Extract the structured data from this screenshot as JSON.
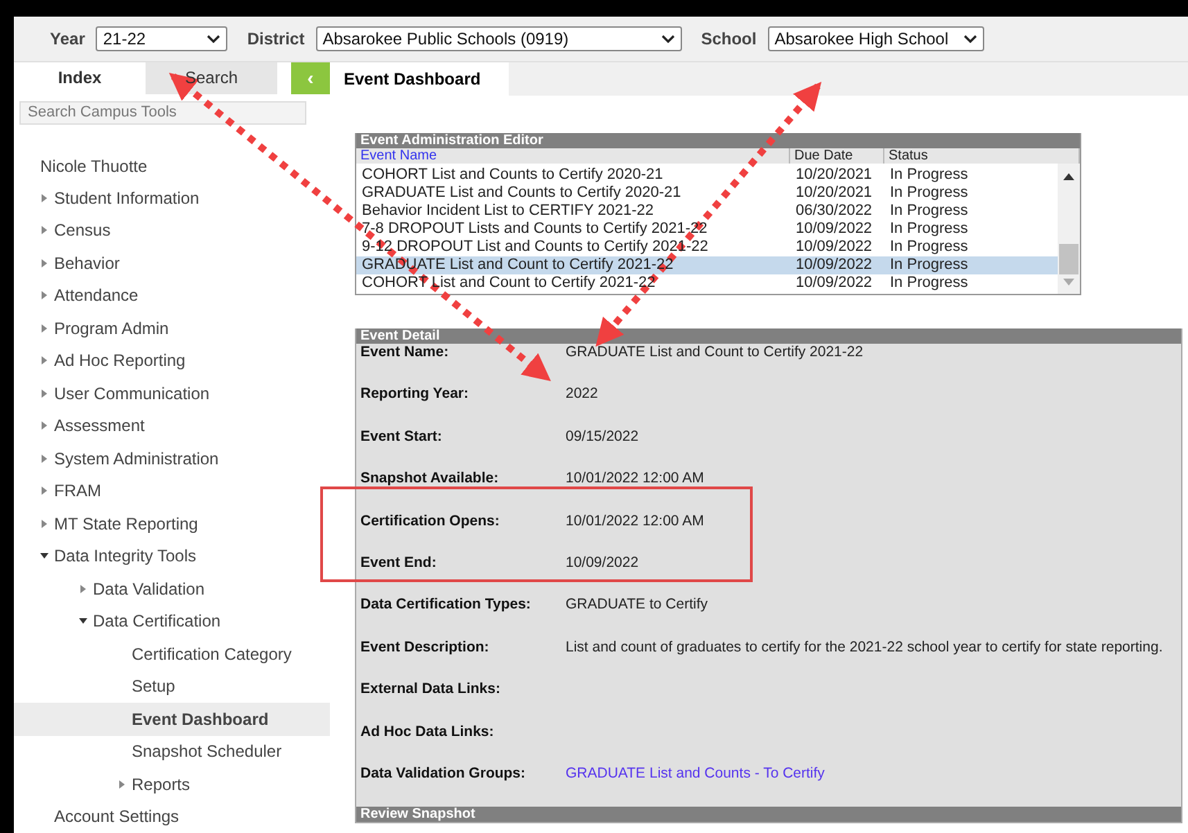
{
  "filters": [
    {
      "label": "Year",
      "value": "21-22"
    },
    {
      "label": "District",
      "value": "Absarokee Public Schools (0919)"
    },
    {
      "label": "School",
      "value": "Absarokee High School"
    }
  ],
  "sidebar": {
    "tabs": [
      {
        "label": "Index",
        "selected": true
      },
      {
        "label": "Search",
        "selected": false
      }
    ],
    "collapse_button": "‹",
    "search": {
      "placeholder": "Search Campus Tools"
    },
    "user": "Nicole Thuotte",
    "items": [
      {
        "label": "Student Information",
        "kind": "folder",
        "expanded": false,
        "selected": false
      },
      {
        "label": "Census",
        "kind": "folder",
        "expanded": false,
        "selected": false
      },
      {
        "label": "Behavior",
        "kind": "folder",
        "expanded": false,
        "selected": false
      },
      {
        "label": "Attendance",
        "kind": "folder",
        "expanded": false,
        "selected": false
      },
      {
        "label": "Program Admin",
        "kind": "folder",
        "expanded": false,
        "selected": false
      },
      {
        "label": "Ad Hoc Reporting",
        "kind": "folder",
        "expanded": false,
        "selected": false
      },
      {
        "label": "User Communication",
        "kind": "folder",
        "expanded": false,
        "selected": false
      },
      {
        "label": "Assessment",
        "kind": "folder",
        "expanded": false,
        "selected": false
      },
      {
        "label": "System Administration",
        "kind": "folder",
        "expanded": false,
        "selected": false
      },
      {
        "label": "FRAM",
        "kind": "folder",
        "expanded": false,
        "selected": false
      },
      {
        "label": "MT State Reporting",
        "kind": "folder",
        "expanded": false,
        "selected": false
      },
      {
        "label": "Data Integrity Tools",
        "kind": "folder",
        "expanded": true,
        "selected": false,
        "children": [
          {
            "label": "Data Validation",
            "kind": "folder",
            "expanded": false,
            "selected": false
          },
          {
            "label": "Data Certification",
            "kind": "folder",
            "expanded": true,
            "selected": false,
            "children": [
              {
                "label": "Certification Category",
                "kind": "page",
                "selected": false
              },
              {
                "label": "Setup",
                "kind": "page",
                "selected": false
              },
              {
                "label": "Event Dashboard",
                "kind": "page",
                "selected": true
              },
              {
                "label": "Snapshot Scheduler",
                "kind": "page",
                "selected": false
              },
              {
                "label": "Reports",
                "kind": "folder",
                "expanded": false,
                "selected": false
              }
            ]
          }
        ]
      },
      {
        "label": "Account Settings",
        "kind": "page",
        "selected": false
      }
    ]
  },
  "page_tab": "Event Dashboard",
  "editor": {
    "title": "Event Administration Editor",
    "columns": [
      "Event Name",
      "Due Date",
      "Status"
    ],
    "rows": [
      {
        "name": "COHORT List and Counts to Certify 2020-21",
        "due": "10/20/2021",
        "status": "In Progress",
        "selected": false
      },
      {
        "name": "GRADUATE List and Counts to Certify 2020-21",
        "due": "10/20/2021",
        "status": "In Progress",
        "selected": false
      },
      {
        "name": "Behavior Incident List to CERTIFY 2021-22",
        "due": "06/30/2022",
        "status": "In Progress",
        "selected": false
      },
      {
        "name": "7-8 DROPOUT Lists and Counts to Certify 2021-22",
        "due": "10/09/2022",
        "status": "In Progress",
        "selected": false
      },
      {
        "name": "9-12 DROPOUT List and Counts to Certify 2021-22",
        "due": "10/09/2022",
        "status": "In Progress",
        "selected": false
      },
      {
        "name": "GRADUATE List and Count to Certify 2021-22",
        "due": "10/09/2022",
        "status": "In Progress",
        "selected": true
      },
      {
        "name": "COHORT List and Count to Certify 2021-22",
        "due": "10/09/2022",
        "status": "In Progress",
        "selected": false
      }
    ]
  },
  "detail": {
    "title": "Event Detail",
    "fields": [
      {
        "label": "Event Name:",
        "value": "GRADUATE List and Count to Certify 2021-22",
        "kind": "text"
      },
      {
        "label": "Reporting Year:",
        "value": "2022",
        "kind": "text"
      },
      {
        "label": "Event Start:",
        "value": "09/15/2022",
        "kind": "text"
      },
      {
        "label": "Snapshot Available:",
        "value": "10/01/2022 12:00 AM",
        "kind": "text"
      },
      {
        "label": "Certification Opens:",
        "value": "10/01/2022 12:00 AM",
        "kind": "text"
      },
      {
        "label": "Event End:",
        "value": "10/09/2022",
        "kind": "text"
      },
      {
        "label": "Data Certification Types:",
        "value": "GRADUATE to Certify",
        "kind": "text"
      },
      {
        "label": "Event Description:",
        "value": "List and count of graduates to certify for the 2021-22 school year to certify for state reporting.",
        "kind": "text"
      },
      {
        "label": "External Data Links:",
        "kind": "text"
      },
      {
        "label": "Ad Hoc Data Links:",
        "kind": "text"
      },
      {
        "label": "Data Validation Groups:",
        "value": "GRADUATE List and Counts - To Certify",
        "kind": "link"
      }
    ]
  },
  "review": {
    "title": "Review Snapshot"
  }
}
